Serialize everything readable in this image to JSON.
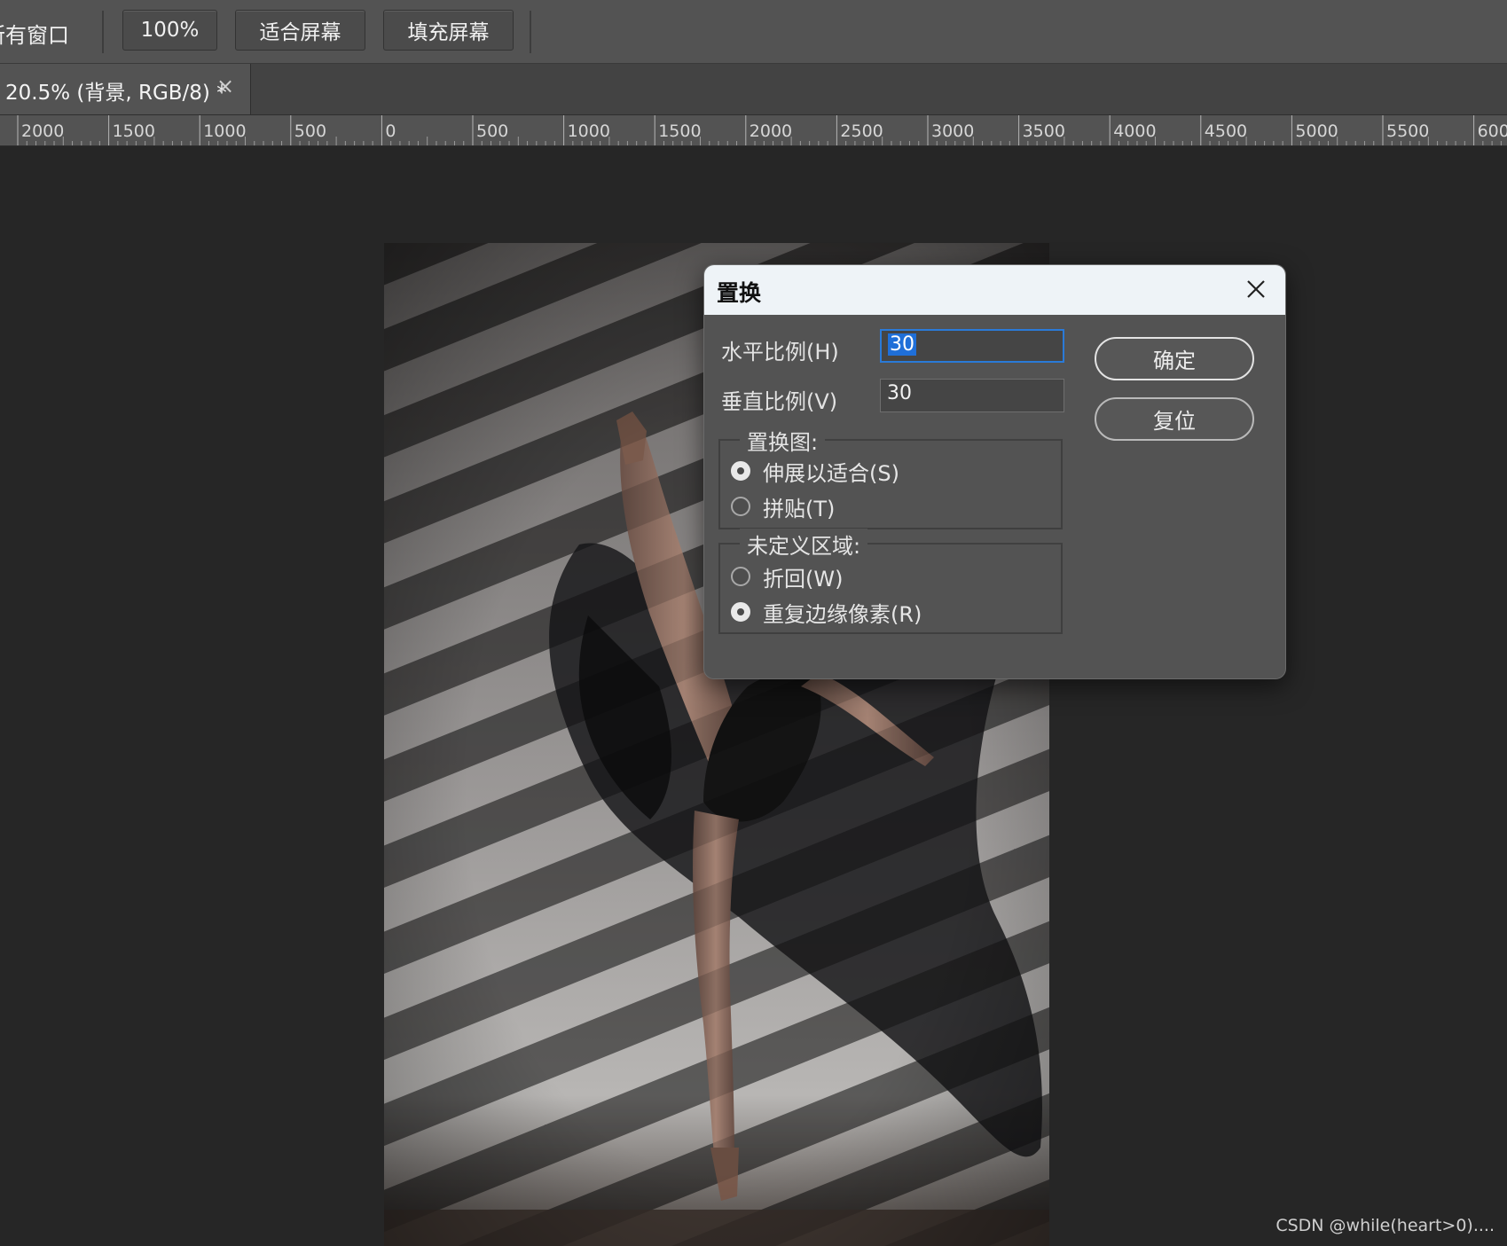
{
  "options_bar": {
    "all_windows_partial": "所有窗口",
    "zoom_100": "100%",
    "fit_screen": "适合屏幕",
    "fill_screen": "填充屏幕"
  },
  "document_tab": {
    "title": "20.5% (背景, RGB/8) *",
    "close_glyph": "×"
  },
  "ruler": {
    "labels": [
      "2000",
      "1500",
      "1000",
      "500",
      "0",
      "500",
      "1000",
      "1500",
      "2000",
      "2500",
      "3000",
      "3500",
      "4000",
      "4500",
      "5000",
      "5500",
      "600"
    ]
  },
  "dialog": {
    "title": "置换",
    "horizontal_label": "水平比例(H)",
    "horizontal_value": "30",
    "vertical_label": "垂直比例(V)",
    "vertical_value": "30",
    "ok_button": "确定",
    "reset_button": "复位",
    "displacement_map": {
      "legend": "置换图:",
      "options": [
        {
          "label": "伸展以适合(S)",
          "checked": true
        },
        {
          "label": "拼贴(T)",
          "checked": false
        }
      ]
    },
    "undefined_areas": {
      "legend": "未定义区域:",
      "options": [
        {
          "label": "折回(W)",
          "checked": false
        },
        {
          "label": "重复边缘像素(R)",
          "checked": true
        }
      ]
    }
  },
  "watermark": "CSDN @while(heart>0)....",
  "colors": {
    "workspace_bg": "#262626",
    "panel_bg": "#535353",
    "focus_blue": "#2a7ad8",
    "dialog_titlebar": "#eef3f7"
  }
}
